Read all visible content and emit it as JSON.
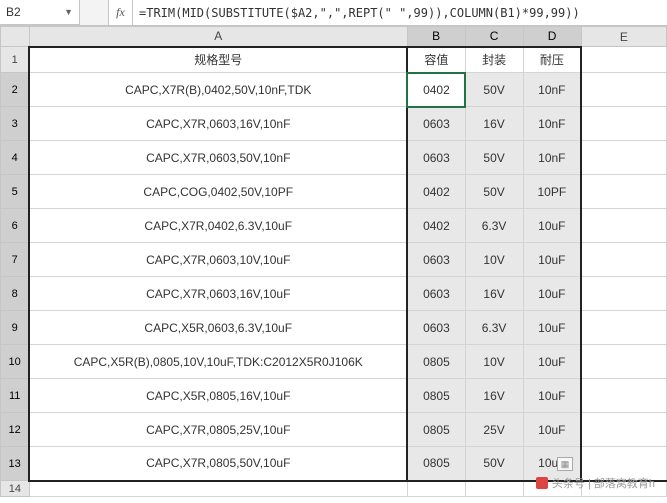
{
  "name_box": "B2",
  "fx_label": "fx",
  "formula": "=TRIM(MID(SUBSTITUTE($A2,\",\",REPT(\" \",99)),COLUMN(B1)*99,99))",
  "columns": [
    "A",
    "B",
    "C",
    "D",
    "E"
  ],
  "header": {
    "a": "规格型号",
    "b": "容值",
    "c": "封装",
    "d": "耐压"
  },
  "rows": [
    {
      "a": "CAPC,X7R(B),0402,50V,10nF,TDK",
      "b": "0402",
      "c": "50V",
      "d": "10nF"
    },
    {
      "a": "CAPC,X7R,0603,16V,10nF",
      "b": "0603",
      "c": "16V",
      "d": "10nF"
    },
    {
      "a": "CAPC,X7R,0603,50V,10nF",
      "b": "0603",
      "c": "50V",
      "d": "10nF"
    },
    {
      "a": "CAPC,COG,0402,50V,10PF",
      "b": "0402",
      "c": "50V",
      "d": "10PF"
    },
    {
      "a": "CAPC,X7R,0402,6.3V,10uF",
      "b": "0402",
      "c": "6.3V",
      "d": "10uF"
    },
    {
      "a": "CAPC,X7R,0603,10V,10uF",
      "b": "0603",
      "c": "10V",
      "d": "10uF"
    },
    {
      "a": "CAPC,X7R,0603,16V,10uF",
      "b": "0603",
      "c": "16V",
      "d": "10uF"
    },
    {
      "a": "CAPC,X5R,0603,6.3V,10uF",
      "b": "0603",
      "c": "6.3V",
      "d": "10uF"
    },
    {
      "a": "CAPC,X5R(B),0805,10V,10uF,TDK:C2012X5R0J106K",
      "b": "0805",
      "c": "10V",
      "d": "10uF"
    },
    {
      "a": "CAPC,X5R,0805,16V,10uF",
      "b": "0805",
      "c": "16V",
      "d": "10uF"
    },
    {
      "a": "CAPC,X7R,0805,25V,10uF",
      "b": "0805",
      "c": "25V",
      "d": "10uF"
    },
    {
      "a": "CAPC,X7R,0805,50V,10uF",
      "b": "0805",
      "c": "50V",
      "d": "10uF"
    }
  ],
  "watermark": "头条号 | 部落窝教育h"
}
